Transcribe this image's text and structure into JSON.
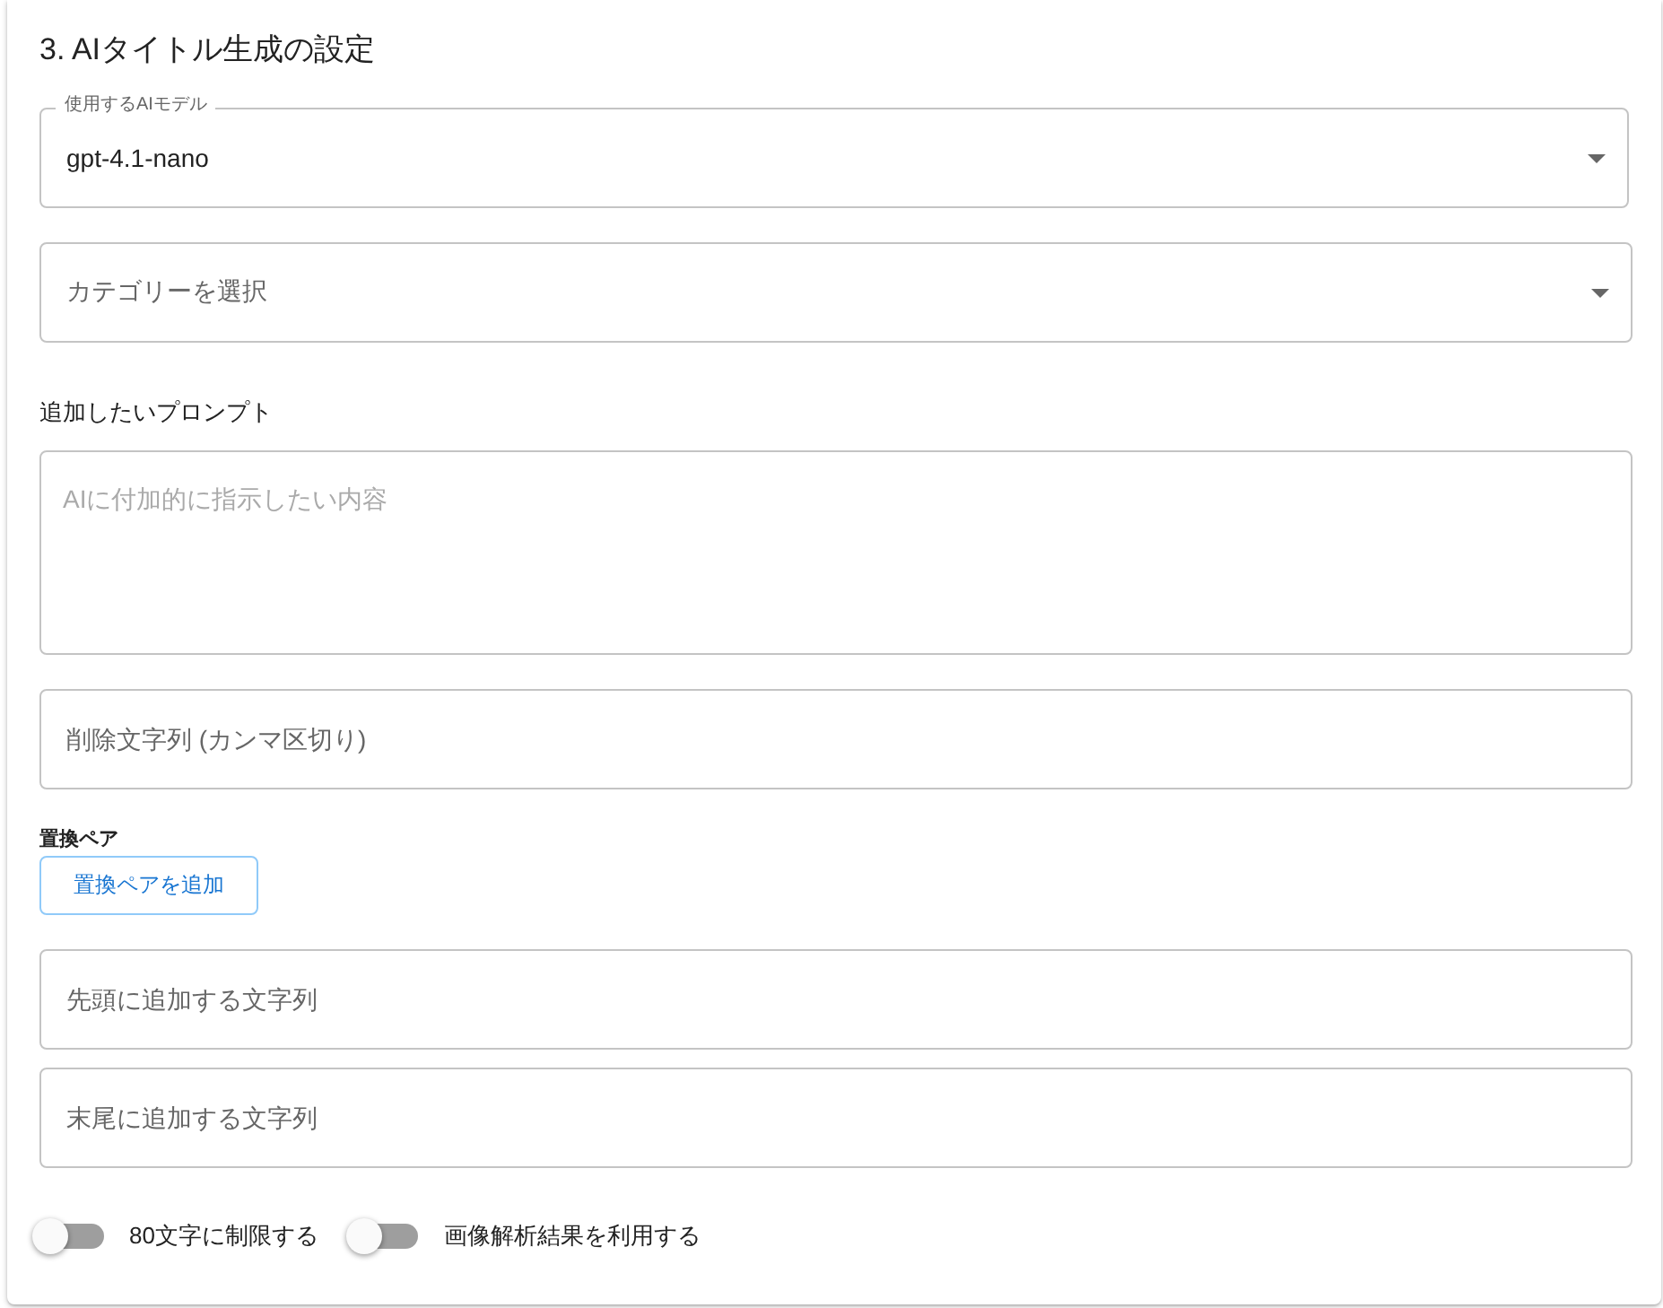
{
  "section_title": "3. AIタイトル生成の設定",
  "model_select": {
    "label": "使用するAIモデル",
    "value": "gpt-4.1-nano"
  },
  "category_select": {
    "placeholder": "カテゴリーを選択"
  },
  "prompt": {
    "label": "追加したいプロンプト",
    "placeholder": "AIに付加的に指示したい内容"
  },
  "remove_field": {
    "placeholder": "削除文字列 (カンマ区切り)"
  },
  "replace_pairs": {
    "label": "置換ペア",
    "button": "置換ペアを追加"
  },
  "prefix_field": {
    "placeholder": "先頭に追加する文字列"
  },
  "suffix_field": {
    "placeholder": "末尾に追加する文字列"
  },
  "toggles": [
    {
      "label": "80文字に制限する",
      "on": false
    },
    {
      "label": "画像解析結果を利用する",
      "on": false
    }
  ]
}
